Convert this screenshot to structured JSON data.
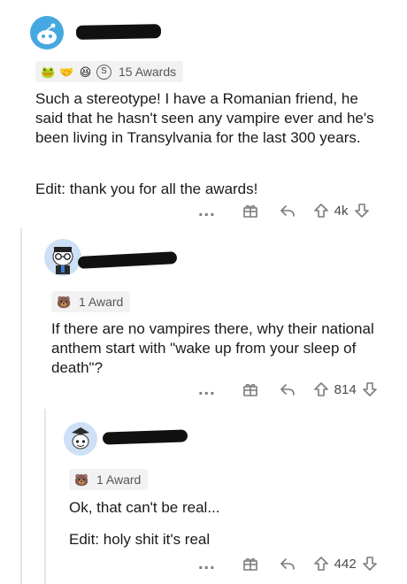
{
  "comments": [
    {
      "awards_label": "15 Awards",
      "body": "Such a stereotype! I have a Romanian friend, he said that he hasn't seen any vampire ever and he's been living in Transylvania for the last 300 years.",
      "edit": "Edit: thank you for all the awards!",
      "score": "4k"
    },
    {
      "awards_label": "1 Award",
      "body": "If there are no vampires there, why their national anthem start with \"wake up from your sleep of death\"?",
      "score": "814"
    },
    {
      "awards_label": "1 Award",
      "body": "Ok, that can't be real...",
      "edit": "Edit: holy shit it's real",
      "score": "442"
    }
  ],
  "actions": {
    "more": "..."
  },
  "colors": {
    "avatar_blue": "#46a8e0",
    "avatar_light": "#cde0f5",
    "thread_line": "#e6e6e6",
    "action_gray": "#7c7c7c"
  },
  "icons": [
    "reddit-avatar-icon",
    "award-icon",
    "gift-icon",
    "reply-icon",
    "upvote-icon",
    "downvote-icon"
  ]
}
